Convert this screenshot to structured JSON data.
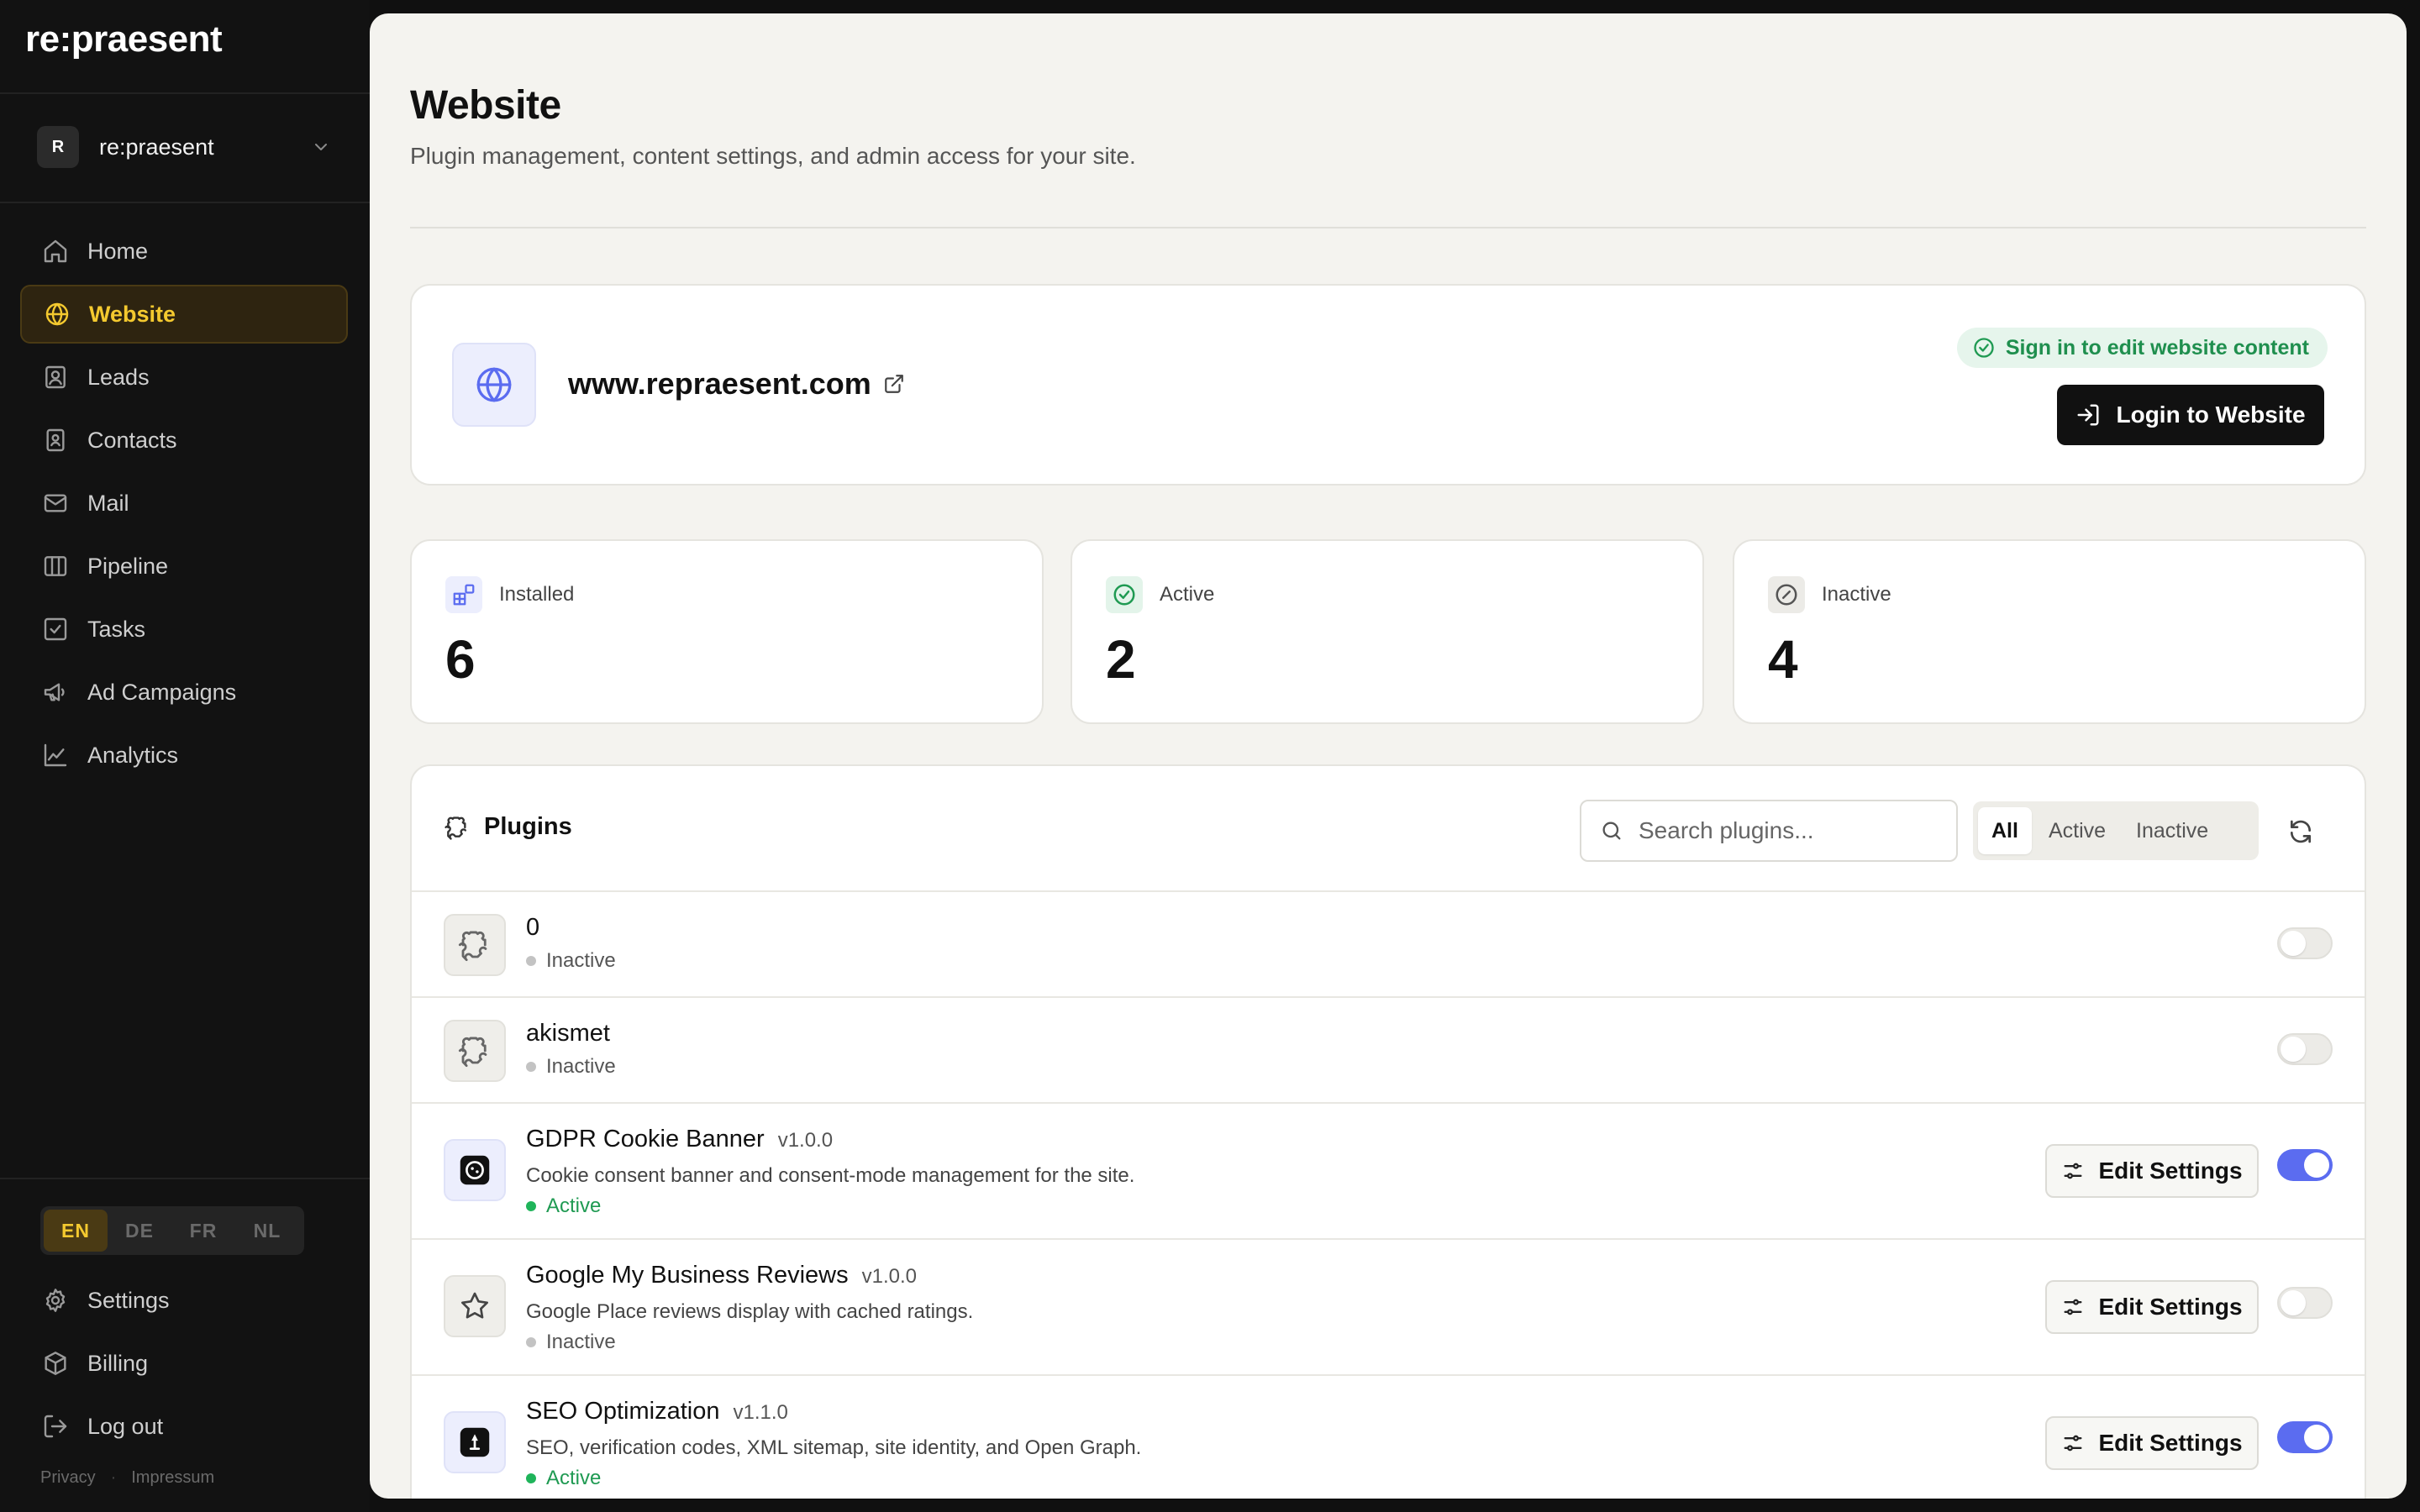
{
  "brand": {
    "logo": "re:praesent"
  },
  "workspace": {
    "avatar_letter": "R",
    "name": "re:praesent"
  },
  "nav": {
    "items": [
      {
        "label": "Home",
        "icon": "home-icon"
      },
      {
        "label": "Website",
        "icon": "globe-icon",
        "active": true
      },
      {
        "label": "Leads",
        "icon": "leads-icon"
      },
      {
        "label": "Contacts",
        "icon": "contacts-icon"
      },
      {
        "label": "Mail",
        "icon": "mail-icon"
      },
      {
        "label": "Pipeline",
        "icon": "pipeline-icon"
      },
      {
        "label": "Tasks",
        "icon": "tasks-icon"
      },
      {
        "label": "Ad Campaigns",
        "icon": "megaphone-icon"
      },
      {
        "label": "Analytics",
        "icon": "analytics-icon"
      }
    ]
  },
  "languages": {
    "items": [
      "EN",
      "DE",
      "FR",
      "NL"
    ],
    "selected": "EN"
  },
  "bottom_nav": {
    "settings": "Settings",
    "billing": "Billing",
    "logout": "Log out"
  },
  "footer": {
    "privacy": "Privacy",
    "separator": "·",
    "impressum": "Impressum"
  },
  "page": {
    "title": "Website",
    "subtitle": "Plugin management, content settings, and admin access for your site."
  },
  "site": {
    "url": "www.repraesent.com",
    "signin_badge": "Sign in to edit website content",
    "login_button": "Login to Website"
  },
  "stats": {
    "installed": {
      "label": "Installed",
      "value": "6"
    },
    "active": {
      "label": "Active",
      "value": "2"
    },
    "inactive": {
      "label": "Inactive",
      "value": "4"
    }
  },
  "plugins": {
    "title": "Plugins",
    "search_placeholder": "Search plugins...",
    "filters": [
      "All",
      "Active",
      "Inactive"
    ],
    "selected_filter": "All",
    "edit_label": "Edit Settings",
    "rows": [
      {
        "name": "0",
        "version": "",
        "description": "",
        "status": "Inactive",
        "enabled": false,
        "icon": "puzzle-icon"
      },
      {
        "name": "akismet",
        "version": "",
        "description": "",
        "status": "Inactive",
        "enabled": false,
        "icon": "puzzle-icon"
      },
      {
        "name": "GDPR Cookie Banner",
        "version": "v1.0.0",
        "description": "Cookie consent banner and consent-mode management for the site.",
        "status": "Active",
        "enabled": true,
        "icon": "cookie-icon"
      },
      {
        "name": "Google My Business Reviews",
        "version": "v1.0.0",
        "description": "Google Place reviews display with cached ratings.",
        "status": "Inactive",
        "enabled": false,
        "icon": "star-icon"
      },
      {
        "name": "SEO Optimization",
        "version": "v1.1.0",
        "description": "SEO, verification codes, XML sitemap, site identity, and Open Graph.",
        "status": "Active",
        "enabled": true,
        "icon": "seo-icon"
      }
    ]
  },
  "colors": {
    "accent_yellow": "#f4c92f",
    "accent_blue": "#5b6cf0",
    "active_green": "#1f9a52",
    "sidebar_bg": "#121212",
    "main_bg": "#f4f3ef"
  }
}
